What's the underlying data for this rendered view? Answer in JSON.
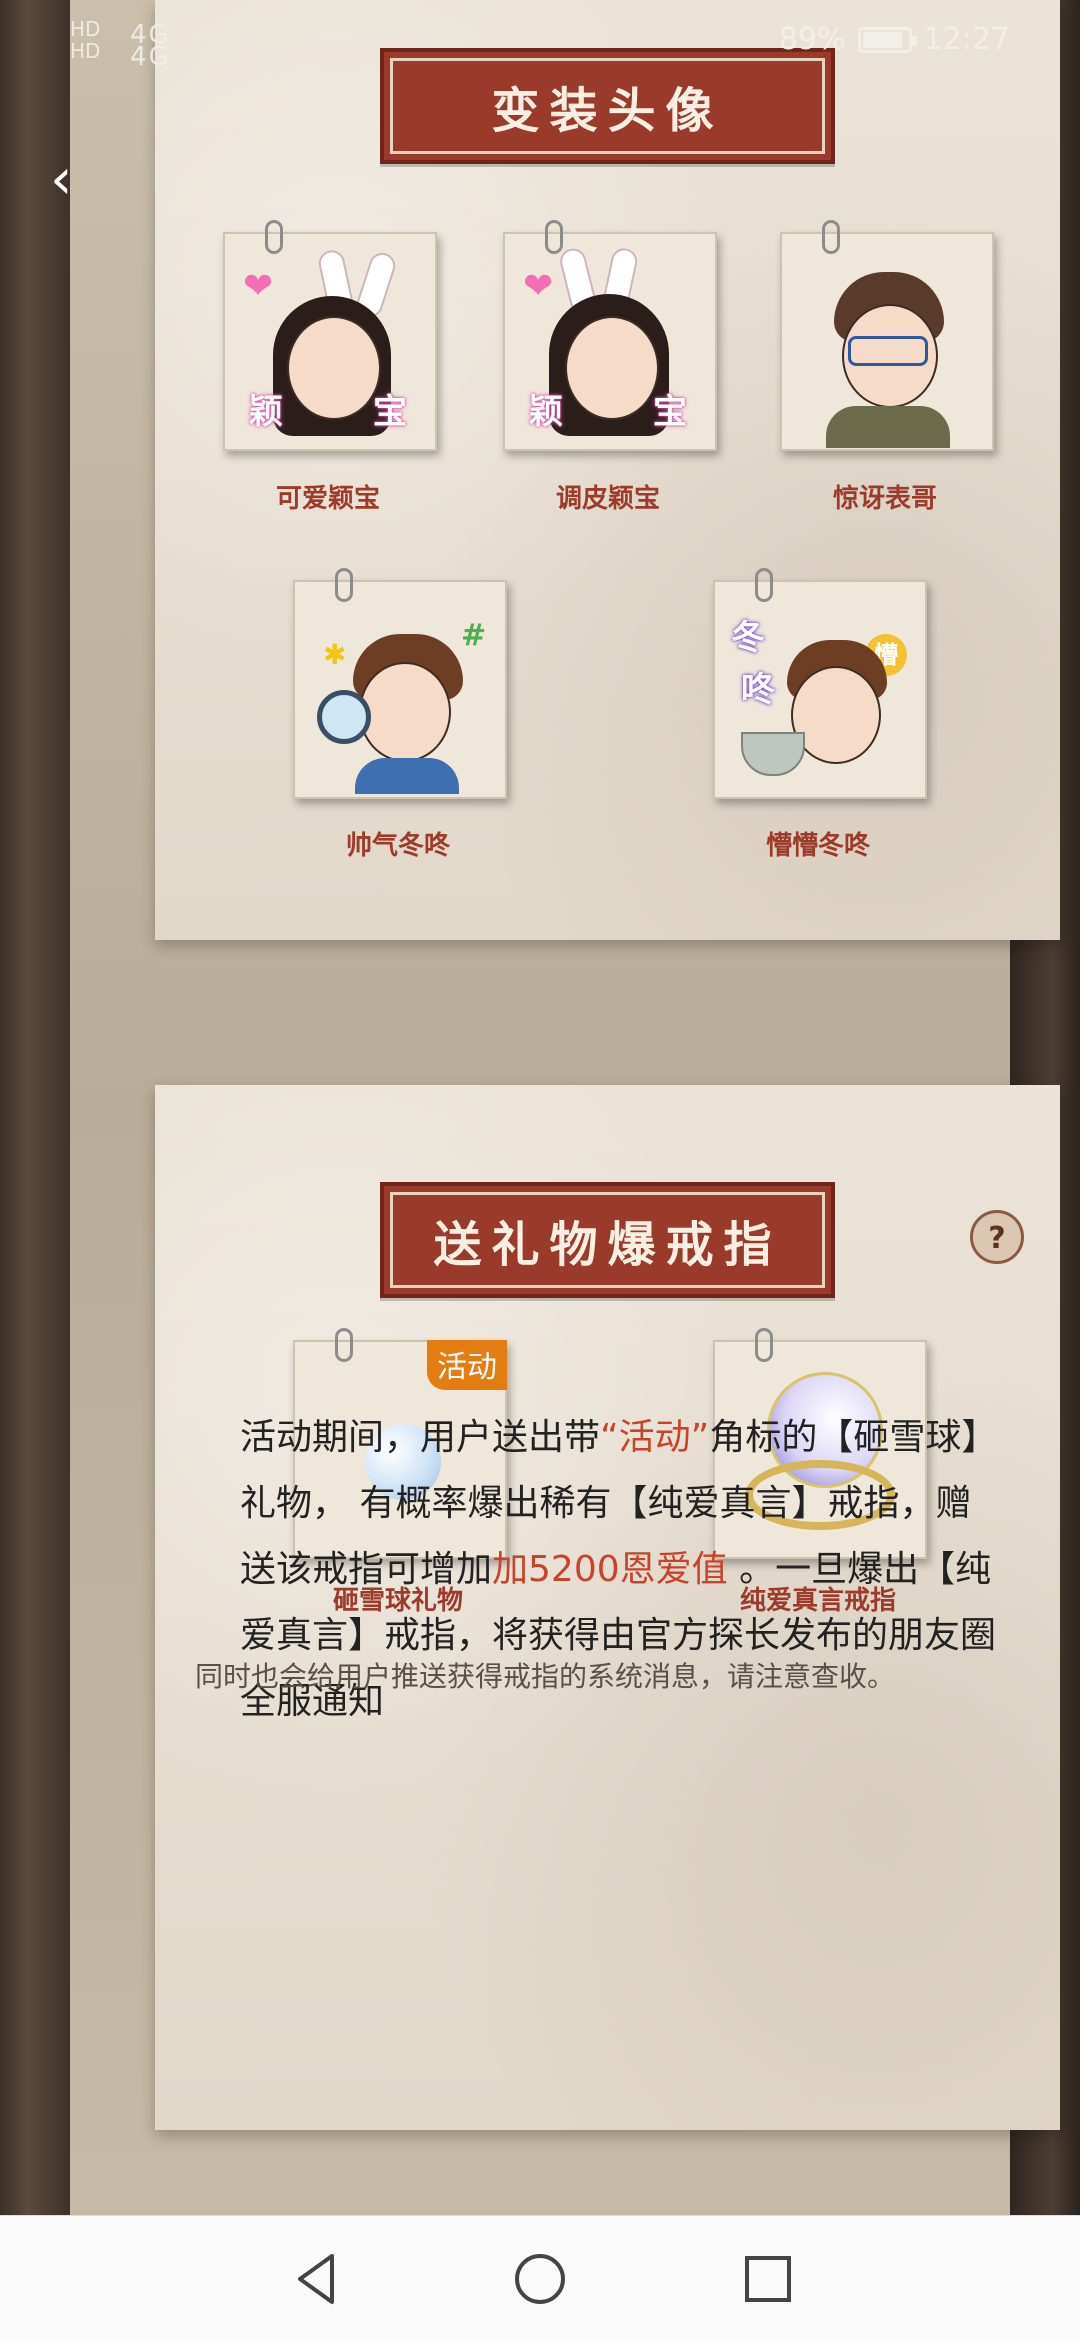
{
  "status_bar": {
    "hd_labels": "HD\nHD",
    "signal_label": "4G 4G",
    "battery_percent_text": "89%",
    "battery_level": 0.89,
    "time": "12:27"
  },
  "section_avatars": {
    "title": "变装头像",
    "items": [
      {
        "label": "可爱颖宝",
        "tag_left": "颖",
        "tag_right": "宝"
      },
      {
        "label": "调皮颖宝",
        "tag_left": "颖",
        "tag_right": "宝"
      },
      {
        "label": "惊讶表哥"
      },
      {
        "label": "帅气冬咚"
      },
      {
        "label": "懵懵冬咚",
        "tag_top": "冬",
        "tag_bottom": "咚",
        "badge": "懵"
      }
    ]
  },
  "section_gifts": {
    "title": "送礼物爆戒指",
    "help": "?",
    "items": [
      {
        "label": "砸雪球礼物",
        "badge": "活动"
      },
      {
        "label": "纯爱真言戒指"
      }
    ],
    "desc_parts": [
      "活动期间，用户送出带",
      "“活动”",
      "角标的【砸雪球】礼物， 有概率爆出稀有【纯爱真言】戒指，赠送该戒指可增加",
      "加5200恩爱值",
      " 。一旦爆出【纯爱真言】戒指，将获得由官方探长发布的朋友圈全服通知"
    ],
    "note": "同时也会给用户推送获得戒指的系统消息，请注意查收。"
  },
  "icons": {
    "back": "chevron-left-icon",
    "nav_back": "triangle-back-icon",
    "nav_home": "circle-home-icon",
    "nav_recents": "square-recents-icon"
  },
  "colors": {
    "banner": "#9a3a2a",
    "label": "#9d3b2a",
    "highlight": "#c8432b",
    "badge": "#e37d12"
  }
}
